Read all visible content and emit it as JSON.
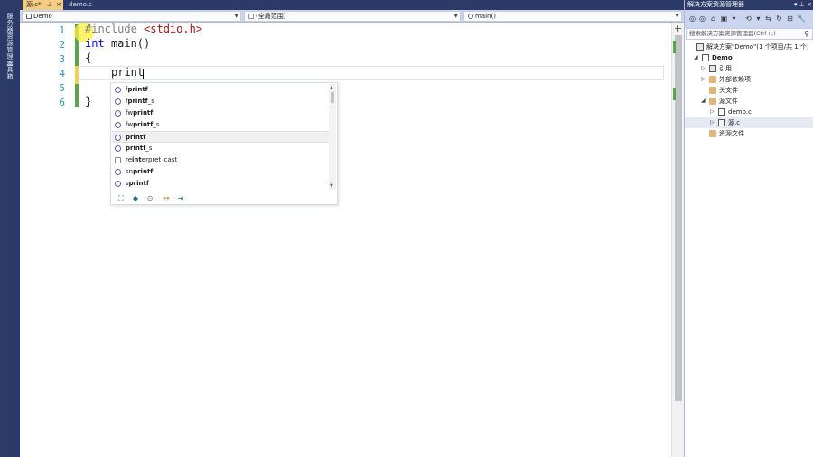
{
  "left_strip": {
    "tabs": [
      "服务器资源管理器",
      "工具箱"
    ]
  },
  "editor_tabs": [
    {
      "label": "源.c*",
      "pin": "⊥",
      "close": "×",
      "active": true
    },
    {
      "label": "demo.c",
      "active": false
    }
  ],
  "nav_bar": {
    "project": "Demo",
    "scope": "(全局范围)",
    "member": "main()"
  },
  "code": {
    "line_numbers": [
      "1",
      "2",
      "3",
      "4",
      "5",
      "6"
    ],
    "lines": {
      "l1_directive": "#include",
      "l1_header": "<stdio.h>",
      "l2_keyword": "int",
      "l2_rest": " main()",
      "l3": "{",
      "l4": "print",
      "l6": "}"
    }
  },
  "completion": {
    "items": [
      {
        "prefix": "f",
        "match": "printf",
        "suffix": "",
        "selected": false
      },
      {
        "prefix": "f",
        "match": "printf",
        "suffix": "_s",
        "selected": false
      },
      {
        "prefix": "fw",
        "match": "printf",
        "suffix": "",
        "selected": false
      },
      {
        "prefix": "fw",
        "match": "printf",
        "suffix": "_s",
        "selected": false
      },
      {
        "prefix": "",
        "match": "printf",
        "suffix": "",
        "selected": true
      },
      {
        "prefix": "",
        "match": "printf",
        "suffix": "_s",
        "selected": false
      },
      {
        "prefix": "re",
        "match": "int",
        "suffix": "erpret_cast",
        "selected": false
      },
      {
        "prefix": "sn",
        "match": "printf",
        "suffix": "",
        "selected": false
      },
      {
        "prefix": "s",
        "match": "printf",
        "suffix": "",
        "selected": false
      }
    ]
  },
  "solution_explorer": {
    "title": "解决方案资源管理器",
    "search_placeholder": "搜索解决方案资源管理器(Ctrl+;)",
    "tree": [
      {
        "label": "解决方案\"Demo\"(1 个项目/共 1 个)",
        "level": 0,
        "expanded": null,
        "icon": "solution-icon"
      },
      {
        "label": "Demo",
        "level": 1,
        "expanded": true,
        "icon": "project-icon",
        "bold": true
      },
      {
        "label": "引用",
        "level": 2,
        "expanded": false,
        "icon": "references-icon"
      },
      {
        "label": "外部依赖项",
        "level": 2,
        "expanded": false,
        "icon": "folder-icon"
      },
      {
        "label": "头文件",
        "level": 2,
        "expanded": null,
        "icon": "folder-icon"
      },
      {
        "label": "源文件",
        "level": 2,
        "expanded": true,
        "icon": "folder-icon"
      },
      {
        "label": "demo.c",
        "level": 3,
        "expanded": false,
        "icon": "c-file-icon"
      },
      {
        "label": "源.c",
        "level": 3,
        "expanded": false,
        "icon": "c-file-icon",
        "selected": true
      },
      {
        "label": "资源文件",
        "level": 2,
        "expanded": null,
        "icon": "folder-icon"
      }
    ]
  },
  "colors": {
    "frame": "#2b3a67",
    "active_tab": "#f5cc84",
    "keyword": "#0000ff",
    "line_number": "#2b91af",
    "change_saved": "#57a64a",
    "change_unsaved": "#f2d34a"
  }
}
